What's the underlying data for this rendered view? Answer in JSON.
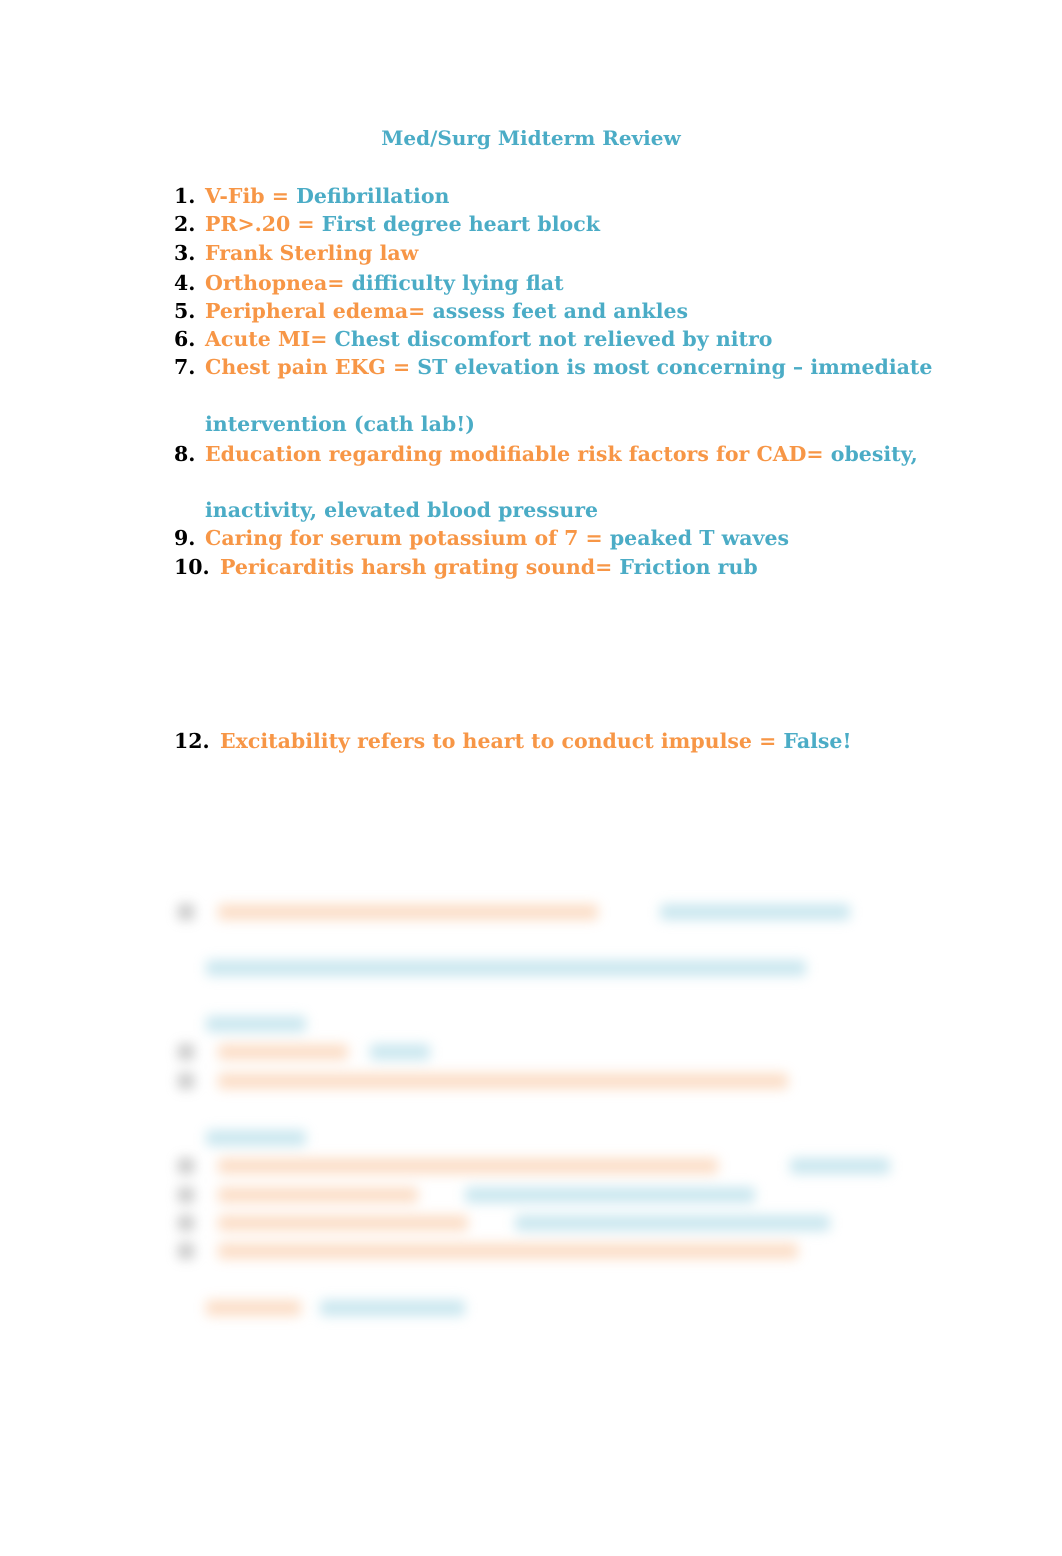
{
  "document": {
    "title": "Med/Surg Midterm Review",
    "colors": {
      "question": "#f79646",
      "answer": "#4bacc6",
      "number": "#000000"
    },
    "items": [
      {
        "number": "1.",
        "question": "V-Fib = ",
        "answer": "Defibrillation"
      },
      {
        "number": "2.",
        "question": "PR>.20 = ",
        "answer": "First degree heart block"
      },
      {
        "number": "3.",
        "question": "Frank Sterling law",
        "answer": ""
      },
      {
        "number": "4.",
        "question": "Orthopnea= ",
        "answer": "difficulty lying flat"
      },
      {
        "number": "5.",
        "question": "Peripheral edema= ",
        "answer": "assess feet and ankles"
      },
      {
        "number": "6.",
        "question": "Acute MI= ",
        "answer": "Chest discomfort not relieved by nitro"
      },
      {
        "number": "7.",
        "question": "Chest pain EKG = ",
        "answer": "ST elevation is most concerning – immediate",
        "continuation": "intervention (cath lab!)"
      },
      {
        "number": "8.",
        "question": "Education regarding modifiable risk factors for CAD= ",
        "answer": "obesity,",
        "continuation": "inactivity, elevated blood pressure"
      },
      {
        "number": "9.",
        "question": "Caring for serum potassium of 7 = ",
        "answer": "peaked T waves"
      },
      {
        "number": "10.",
        "question": "Pericarditis harsh grating sound= ",
        "answer": "Friction rub"
      },
      {
        "number": "12.",
        "question": "Excitability refers to heart to conduct impulse = ",
        "answer": "False!"
      }
    ],
    "blurred_section_note": "Remaining content obscured (blurred preview)"
  }
}
